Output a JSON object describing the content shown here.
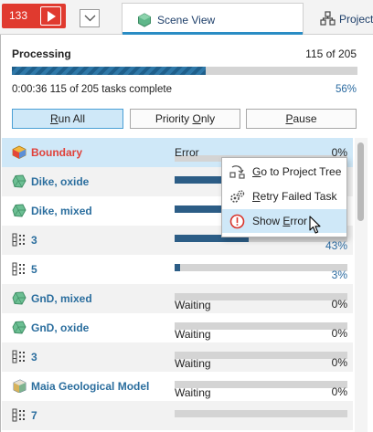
{
  "topbar": {
    "badge_count": "133",
    "tabs": [
      {
        "label": "Scene View",
        "icon": "scene-view-icon"
      },
      {
        "label": "Project",
        "icon": "project-tree-icon"
      }
    ]
  },
  "processing": {
    "title": "Processing",
    "count": "115 of 205",
    "progress": 0.56,
    "elapsed": "0:00:36 115 of 205 tasks complete",
    "percent": "56%",
    "buttons": {
      "run_all_pre": "",
      "run_all_ul": "R",
      "run_all_post": "un All",
      "priority_pre": "Priority ",
      "priority_ul": "O",
      "priority_post": "nly",
      "pause_pre": "",
      "pause_ul": "P",
      "pause_post": "ause"
    }
  },
  "tasks": [
    {
      "name": "Boundary",
      "icon": "boundary-icon",
      "status": "Error",
      "percent": "0%",
      "progress": 0,
      "error": true
    },
    {
      "name": "Dike, oxide",
      "icon": "geology-volume-icon",
      "status": "",
      "percent": "",
      "progress": 0.6
    },
    {
      "name": "Dike, mixed",
      "icon": "geology-volume-icon",
      "status": "",
      "percent": "",
      "progress": 0.45
    },
    {
      "name": "3",
      "icon": "grid-points-icon",
      "status": "",
      "percent": "43%",
      "progress": 0.43
    },
    {
      "name": "5",
      "icon": "grid-points-icon",
      "status": "",
      "percent": "3%",
      "progress": 0.03
    },
    {
      "name": "GnD, mixed",
      "icon": "geology-volume-icon",
      "status": "Waiting",
      "percent": "0%",
      "progress": 0
    },
    {
      "name": "GnD, oxide",
      "icon": "geology-volume-icon",
      "status": "Waiting",
      "percent": "0%",
      "progress": 0
    },
    {
      "name": "3",
      "icon": "grid-points-icon",
      "status": "Waiting",
      "percent": "0%",
      "progress": 0
    },
    {
      "name": "Maia Geological Model",
      "icon": "geological-model-icon",
      "status": "Waiting",
      "percent": "0%",
      "progress": 0
    },
    {
      "name": "7",
      "icon": "grid-points-icon",
      "status": "",
      "percent": "",
      "progress": 0
    }
  ],
  "context_menu": {
    "items": [
      {
        "pre": "",
        "ul": "G",
        "post": "o to Project Tree",
        "icon": "project-tree-icon"
      },
      {
        "pre": "",
        "ul": "R",
        "post": "etry Failed Task",
        "icon": "gears-icon"
      },
      {
        "pre": "Show ",
        "ul": "E",
        "post": "rror",
        "icon": "error-icon"
      }
    ]
  },
  "colors": {
    "accent": "#2a8cc4",
    "error": "#e0413a",
    "link_blue": "#2b6e9e",
    "selected": "#cfe8f8"
  }
}
